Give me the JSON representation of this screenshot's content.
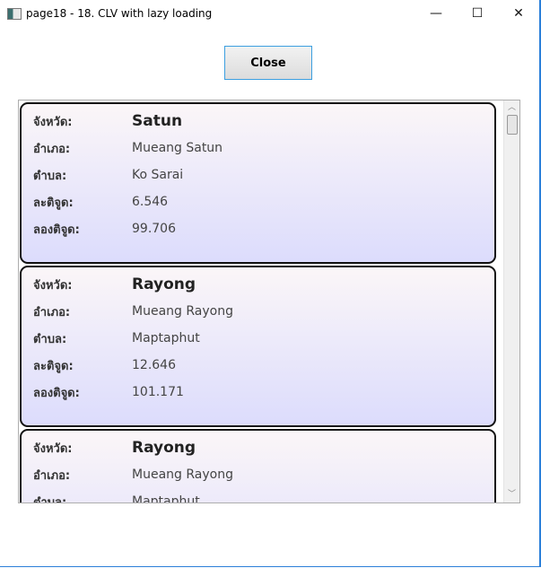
{
  "window": {
    "title": "page18 - 18. CLV with lazy loading",
    "minimize": "—",
    "maximize": "☐",
    "close": "✕"
  },
  "close_button": "Close",
  "labels": {
    "province": "จังหวัด:",
    "district": "อำเภอ:",
    "subdistrict": "ตำบล:",
    "latitude": "ละติจูด:",
    "longitude": "ลองติจูด:"
  },
  "items": [
    {
      "province": "Satun",
      "district": "Mueang Satun",
      "subdistrict": "Ko Sarai",
      "latitude": "6.546",
      "longitude": "99.706"
    },
    {
      "province": "Rayong",
      "district": "Mueang Rayong",
      "subdistrict": "Maptaphut",
      "latitude": "12.646",
      "longitude": "101.171"
    },
    {
      "province": "Rayong",
      "district": "Mueang Rayong",
      "subdistrict": "Maptaphut",
      "latitude": "",
      "longitude": ""
    }
  ],
  "scrollbar": {
    "up": "︿",
    "down": "﹀"
  }
}
